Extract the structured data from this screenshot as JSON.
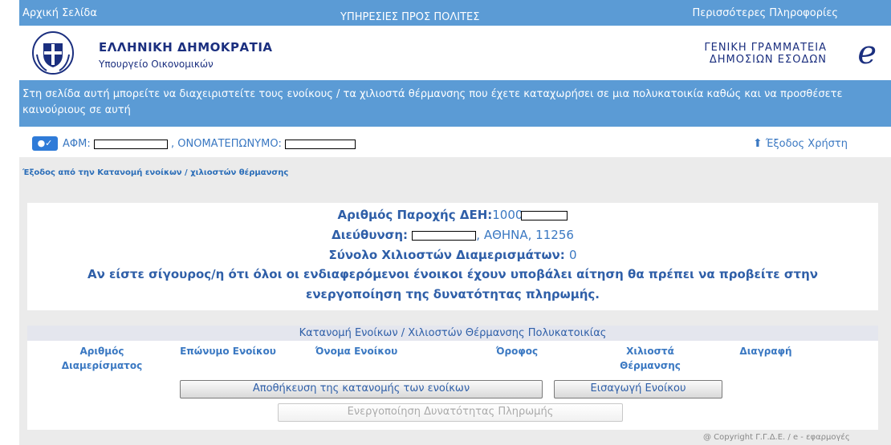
{
  "topbar": {
    "home": "Αρχική Σελίδα",
    "center": "ΥΠΗΡΕΣΙΕΣ ΠΡΟΣ ΠΟΛΙΤΕΣ",
    "more": "Περισσότερες Πληροφορίες"
  },
  "header": {
    "brand_title": "ΕΛΛΗΝΙΚΗ ΔΗΜΟΚΡΑΤΙΑ",
    "brand_sub": "Υπουργείο Οικονομικών",
    "gsis_line1": "ΓΕΝΙΚΗ ΓΡΑΜΜΑΤΕΙΑ",
    "gsis_line2": "ΔΗΜΟΣΙΩΝ ΕΣΟΔΩΝ"
  },
  "infobar": {
    "text": "Στη σελίδα αυτή μπορείτε να διαχειριστείτε τους ενοίκους / τα χιλιοστά θέρμανσης που έχετε καταχωρήσει σε μια πολυκατοικία καθώς και να προσθέσετε καινούριους σε αυτή"
  },
  "user": {
    "afm_label": "ΑΦΜ:",
    "name_label": ", ΟΝΟΜΑΤΕΠΩΝΥΜΟ:",
    "logout": "Έξοδος Χρήστη"
  },
  "exit_link": "Έξοδος από την Κατανομή ενοίκων / χιλιοστών θέρμανσης",
  "info": {
    "supply_label": "Αριθμός Παροχής ΔΕΗ:",
    "supply_value": "1000",
    "address_label": "Διεύθυνση:",
    "address_value": ", ΑΘΗΝΑ, 11256",
    "total_label": "Σύνολο Χιλιοστών Διαμερισμάτων:",
    "total_value": "0",
    "notice_line1": "Αν είστε σίγουρος/η ότι όλοι οι ενδιαφερόμενοι ένοικοι έχουν υποβάλει αίτηση θα πρέπει να προβείτε στην",
    "notice_line2": "ενεργοποίηση της δυνατότητας πληρωμής."
  },
  "table": {
    "title": "Κατανομή Ενοίκων / Χιλιοστών Θέρμανσης Πολυκατοικίας",
    "col_apartment_1": "Αριθμός",
    "col_apartment_2": "Διαμερίσματος",
    "col_surname": "Επώνυμο Ενοίκου",
    "col_name": "Όνομα Ενοίκου",
    "col_floor": "Όροφος",
    "col_thousandths_1": "Χιλιοστά",
    "col_thousandths_2": "Θέρμανσης",
    "col_delete": "Διαγραφή"
  },
  "buttons": {
    "save": "Αποθήκευση της κατανομής των ενοίκων",
    "add_tenant": "Εισαγωγή Ενοίκου",
    "enable_payment": "Ενεργοποίηση Δυνατότητας Πληρωμής"
  },
  "footer": {
    "copyright": "@ Copyright Γ.Γ.Δ.Ε. / e - εφαρμογές"
  }
}
